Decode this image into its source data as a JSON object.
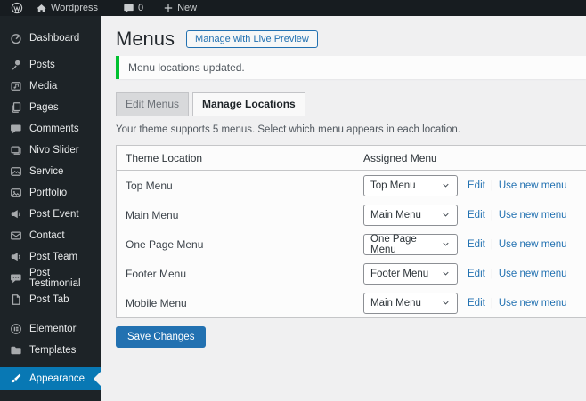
{
  "admin_bar": {
    "site_name": "Wordpress",
    "comments_count": "0",
    "new_label": "New"
  },
  "sidebar": {
    "items": [
      {
        "label": "Dashboard",
        "icon": "dashboard-icon"
      },
      {
        "label": "Posts",
        "icon": "pin-icon"
      },
      {
        "label": "Media",
        "icon": "media-icon"
      },
      {
        "label": "Pages",
        "icon": "pages-icon"
      },
      {
        "label": "Comments",
        "icon": "comment-bubble-icon"
      },
      {
        "label": "Nivo Slider",
        "icon": "slides-icon"
      },
      {
        "label": "Service",
        "icon": "image-card-icon"
      },
      {
        "label": "Portfolio",
        "icon": "image-card-icon"
      },
      {
        "label": "Post Event",
        "icon": "megaphone-icon"
      },
      {
        "label": "Contact",
        "icon": "envelope-icon"
      },
      {
        "label": "Post Team",
        "icon": "megaphone-icon"
      },
      {
        "label": "Post Testimonial",
        "icon": "testimonial-bubble-icon"
      },
      {
        "label": "Post Tab",
        "icon": "document-icon"
      },
      {
        "label": "Elementor",
        "icon": "elementor-icon"
      },
      {
        "label": "Templates",
        "icon": "folder-icon"
      },
      {
        "label": "Appearance",
        "icon": "paintbrush-icon",
        "active": true
      }
    ]
  },
  "page": {
    "title": "Menus",
    "live_preview_button": "Manage with Live Preview",
    "notice": "Menu locations updated.",
    "tabs": [
      {
        "label": "Edit Menus",
        "active": false
      },
      {
        "label": "Manage Locations",
        "active": true
      }
    ],
    "description": "Your theme supports 5 menus. Select which menu appears in each location.",
    "save_button": "Save Changes"
  },
  "table": {
    "headers": [
      "Theme Location",
      "Assigned Menu"
    ],
    "actions": {
      "edit": "Edit",
      "separator": "|",
      "use_new": "Use new menu"
    },
    "rows": [
      {
        "location": "Top Menu",
        "selected": "Top Menu"
      },
      {
        "location": "Main Menu",
        "selected": "Main Menu"
      },
      {
        "location": "One Page Menu",
        "selected": "One Page Menu"
      },
      {
        "location": "Footer Menu",
        "selected": "Footer Menu"
      },
      {
        "location": "Mobile Menu",
        "selected": "Main Menu"
      }
    ]
  },
  "colors": {
    "accent_blue": "#2271b1",
    "active_item_blue": "#0878b4",
    "success_green": "#00c12f",
    "admin_dark": "#1d2327"
  }
}
